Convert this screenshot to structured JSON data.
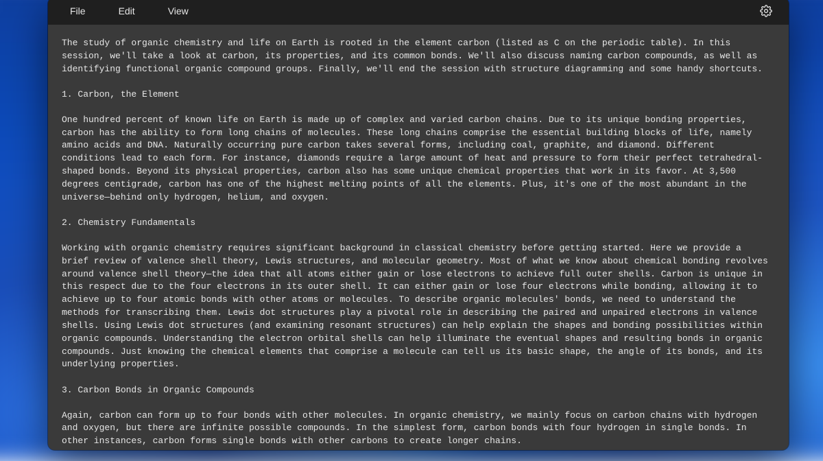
{
  "menu": {
    "file": "File",
    "edit": "Edit",
    "view": "View"
  },
  "document": {
    "paragraphs": [
      "The study of organic chemistry and life on Earth is rooted in the element carbon (listed as C on the periodic table). In this session, we'll take a look at carbon, its properties, and its common bonds. We'll also discuss naming carbon compounds, as well as identifying functional organic compound groups. Finally, we'll end the session with structure diagramming and some handy shortcuts.",
      "1. Carbon, the Element",
      "One hundred percent of known life on Earth is made up of complex and varied carbon chains. Due to its unique bonding properties, carbon has the ability to form long chains of molecules. These long chains comprise the essential building blocks of life, namely amino acids and DNA. Naturally occurring pure carbon takes several forms, including coal, graphite, and diamond. Different conditions lead to each form. For instance, diamonds require a large amount of heat and pressure to form their perfect tetrahedral-shaped bonds. Beyond its physical properties, carbon also has some unique chemical properties that work in its favor. At 3,500 degrees centigrade, carbon has one of the highest melting points of all the elements. Plus, it's one of the most abundant in the universe—behind only hydrogen, helium, and oxygen.",
      "2. Chemistry Fundamentals",
      "Working with organic chemistry requires significant background in classical chemistry before getting started. Here we provide a brief review of valence shell theory, Lewis structures, and molecular geometry. Most of what we know about chemical bonding revolves around valence shell theory—the idea that all atoms either gain or lose electrons to achieve full outer shells. Carbon is unique in this respect due to the four electrons in its outer shell. It can either gain or lose four electrons while bonding, allowing it to achieve up to four atomic bonds with other atoms or molecules. To describe organic molecules' bonds, we need to understand the methods for transcribing them. Lewis dot structures play a pivotal role in describing the paired and unpaired electrons in valence shells. Using Lewis dot structures (and examining resonant structures) can help explain the shapes and bonding possibilities within organic compounds. Understanding the electron orbital shells can help illuminate the eventual shapes and resulting bonds in organic compounds. Just knowing the chemical elements that comprise a molecule can tell us its basic shape, the angle of its bonds, and its underlying properties.",
      "3. Carbon Bonds in Organic Compounds",
      "Again, carbon can form up to four bonds with other molecules. In organic chemistry, we mainly focus on carbon chains with hydrogen and oxygen, but there are infinite possible compounds. In the simplest form, carbon bonds with four hydrogen in single bonds. In other instances, carbon forms single bonds with other carbons to create longer chains."
    ]
  }
}
